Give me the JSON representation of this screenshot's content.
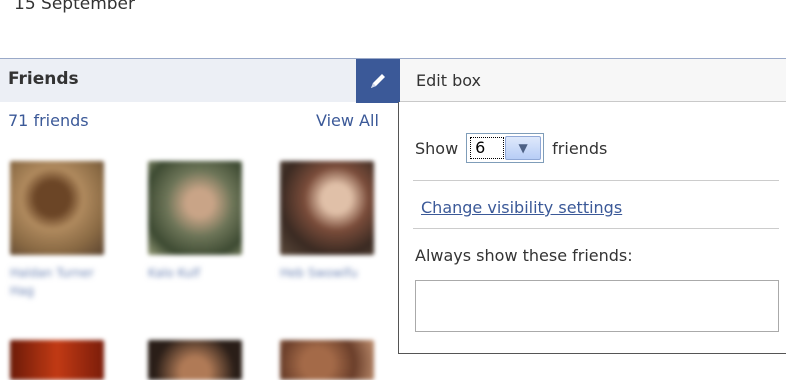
{
  "profile": {
    "date_text": "15 September"
  },
  "friends": {
    "title": "Friends",
    "count_text": "71 friends",
    "view_all_label": "View All",
    "names": [
      "Haldan Turner Hag",
      "Kalo Kulf",
      "Heb Swowifu"
    ]
  },
  "edit_box": {
    "tab_label": "Edit box",
    "show_label": "Show",
    "show_value": "6",
    "friends_suffix": "friends",
    "visibility_link": "Change visibility settings",
    "always_show_label": "Always show these friends:",
    "always_show_value": "",
    "icon": "pencil-icon"
  },
  "colors": {
    "accent": "#3b5998",
    "header_bg": "#eceff5"
  }
}
